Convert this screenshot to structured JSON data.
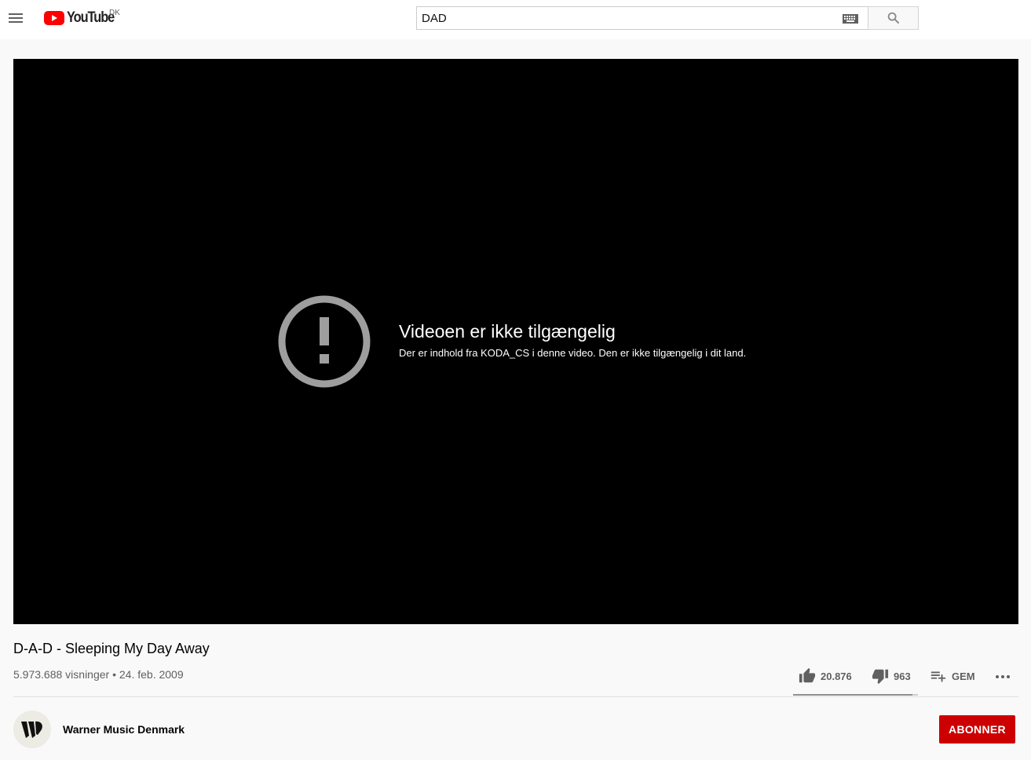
{
  "header": {
    "logo_text": "YouTube",
    "country_code": "DK",
    "search": {
      "value": "DAD",
      "placeholder": ""
    },
    "icons": {
      "menu": "hamburger-menu-icon",
      "keyboard": "keyboard-icon",
      "search": "search-icon"
    }
  },
  "player": {
    "error_title": "Videoen er ikke tilgængelig",
    "error_message": "Der er indhold fra KODA_CS i denne video. Den er ikke tilgængelig i dit land.",
    "error_icon": "alert-circle-icon"
  },
  "video": {
    "title": "D-A-D - Sleeping My Day Away",
    "meta": "5.973.688 visninger • 24. feb. 2009",
    "likes": "20.876",
    "dislikes": "963",
    "like_ratio": 0.956,
    "save_label": "GEM",
    "more_icon": "more-horizontal-icon"
  },
  "channel": {
    "name": "Warner Music Denmark",
    "subscribe_label": "ABONNER"
  },
  "colors": {
    "brand_red": "#ff0000",
    "subscribe_red": "#cc0000",
    "player_bg": "#000000",
    "page_bg": "#f9f9f9"
  }
}
